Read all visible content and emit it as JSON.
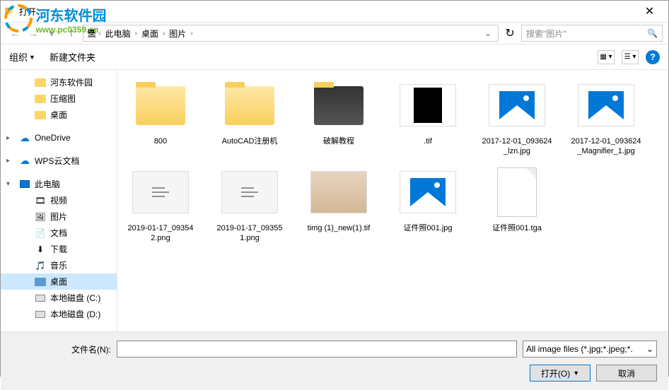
{
  "watermark": {
    "title": "河东软件园",
    "url": "www.pc0359.cn"
  },
  "window": {
    "title": "打开"
  },
  "nav": {
    "crumbs": [
      "此电脑",
      "桌面",
      "图片"
    ],
    "search_placeholder": "搜索\"图片\""
  },
  "toolbar": {
    "organize": "组织",
    "newfolder": "新建文件夹"
  },
  "sidebar": {
    "items": [
      {
        "label": "河东软件园",
        "type": "folder",
        "indent": 1
      },
      {
        "label": "压缩图",
        "type": "folder",
        "indent": 1
      },
      {
        "label": "桌面",
        "type": "folder",
        "indent": 1
      },
      {
        "label": "OneDrive",
        "type": "cloud",
        "indent": 0,
        "exp": "▸"
      },
      {
        "label": "WPS云文档",
        "type": "cloud",
        "indent": 0,
        "exp": "▸"
      },
      {
        "label": "此电脑",
        "type": "pc",
        "indent": 0,
        "exp": "▾"
      },
      {
        "label": "视频",
        "type": "video",
        "indent": 2
      },
      {
        "label": "图片",
        "type": "pic",
        "indent": 2
      },
      {
        "label": "文档",
        "type": "doc",
        "indent": 2
      },
      {
        "label": "下载",
        "type": "dl",
        "indent": 2
      },
      {
        "label": "音乐",
        "type": "music",
        "indent": 2
      },
      {
        "label": "桌面",
        "type": "desktop",
        "indent": 2,
        "selected": true
      },
      {
        "label": "本地磁盘 (C:)",
        "type": "drive",
        "indent": 2
      },
      {
        "label": "本地磁盘 (D:)",
        "type": "drive",
        "indent": 2
      }
    ]
  },
  "files": [
    {
      "name": "800",
      "type": "folder"
    },
    {
      "name": "AutoCAD注册机",
      "type": "folder"
    },
    {
      "name": "破解教程",
      "type": "folder-thumb"
    },
    {
      "name": ".tif",
      "type": "image-bw"
    },
    {
      "name": "2017-12-01_093624_lzn.jpg",
      "type": "image-icon"
    },
    {
      "name": "2017-12-01_093624_Magnifier_1.jpg",
      "type": "image-icon"
    },
    {
      "name": "2019-01-17_093542.png",
      "type": "image-shot"
    },
    {
      "name": "2019-01-17_093551.png",
      "type": "image-shot"
    },
    {
      "name": "timg (1)_new(1).tif",
      "type": "image-photo"
    },
    {
      "name": "证件照001.jpg",
      "type": "image-icon"
    },
    {
      "name": "证件照001.tga",
      "type": "doc"
    }
  ],
  "footer": {
    "filename_label": "文件名(N):",
    "filetype": "All image files (*.jpg;*.jpeg;*.",
    "open": "打开(O)",
    "cancel": "取消"
  }
}
